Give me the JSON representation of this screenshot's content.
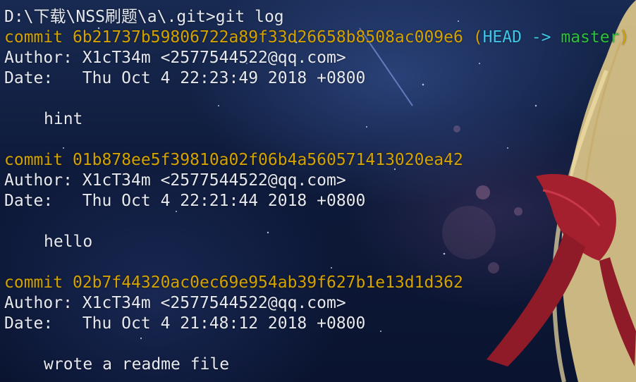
{
  "prompt": {
    "path": "D:\\下载\\NSS刷题\\a\\.git>",
    "command": "git log"
  },
  "colors": {
    "commit": "#d4a300",
    "head": "#3fc6e6",
    "branch": "#2ec13b",
    "text": "#e6e9f0"
  },
  "commits": [
    {
      "commit_label": "commit",
      "hash": "6b21737b59806722a89f33d26658b8508ac009e6",
      "ref_open": "(",
      "head": "HEAD ->",
      "branch": "master",
      "ref_close": ")",
      "author_label": "Author:",
      "author": "X1cT34m <2577544522@qq.com>",
      "date_label": "Date:",
      "date": "Thu Oct 4 22:23:49 2018 +0800",
      "message": "hint"
    },
    {
      "commit_label": "commit",
      "hash": "01b878ee5f39810a02f06b4a560571413020ea42",
      "author_label": "Author:",
      "author": "X1cT34m <2577544522@qq.com>",
      "date_label": "Date:",
      "date": "Thu Oct 4 22:21:44 2018 +0800",
      "message": "hello"
    },
    {
      "commit_label": "commit",
      "hash": "02b7f44320ac0ec69e954ab39f627b1e13d1d362",
      "author_label": "Author:",
      "author": "X1cT34m <2577544522@qq.com>",
      "date_label": "Date:",
      "date": "Thu Oct 4 21:48:12 2018 +0800",
      "message": "wrote a readme file"
    }
  ]
}
